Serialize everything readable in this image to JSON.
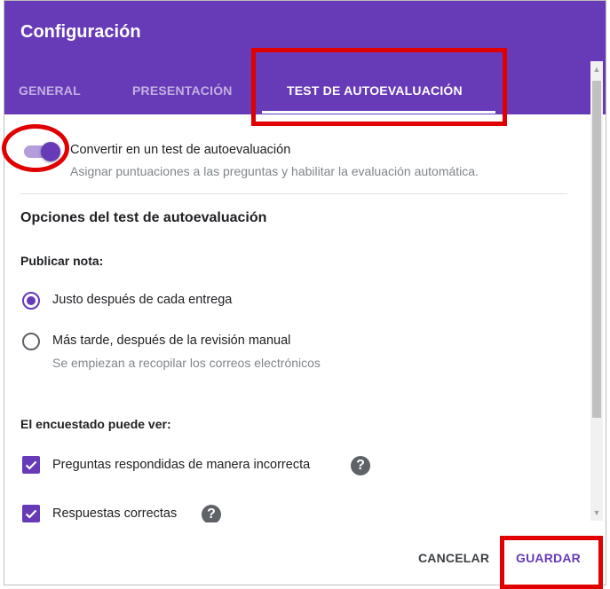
{
  "dialog": {
    "title": "Configuración",
    "tabs": [
      {
        "label": "GENERAL",
        "active": false
      },
      {
        "label": "PRESENTACIÓN",
        "active": false
      },
      {
        "label": "TEST DE AUTOEVALUACIÓN",
        "active": true
      }
    ]
  },
  "quiz_toggle": {
    "label": "Convertir en un test de autoevaluación",
    "description": "Asignar puntuaciones a las preguntas y habilitar la evaluación automática.",
    "enabled": true
  },
  "options": {
    "title": "Opciones del test de autoevaluación",
    "publish_label": "Publicar nota:",
    "publish_options": [
      {
        "label": "Justo después de cada entrega",
        "checked": true
      },
      {
        "label": "Más tarde, después de la revisión manual",
        "sublabel": "Se empiezan a recopilar los correos electrónicos",
        "checked": false
      }
    ],
    "respondent_label": "El encuestado puede ver:",
    "respondent_options": [
      {
        "label": "Preguntas respondidas de manera incorrecta",
        "checked": true
      },
      {
        "label": "Respuestas correctas",
        "checked": true
      }
    ]
  },
  "footer": {
    "cancel_label": "CANCELAR",
    "save_label": "GUARDAR"
  },
  "colors": {
    "brand": "#673ab7",
    "highlight": "#e00000"
  }
}
